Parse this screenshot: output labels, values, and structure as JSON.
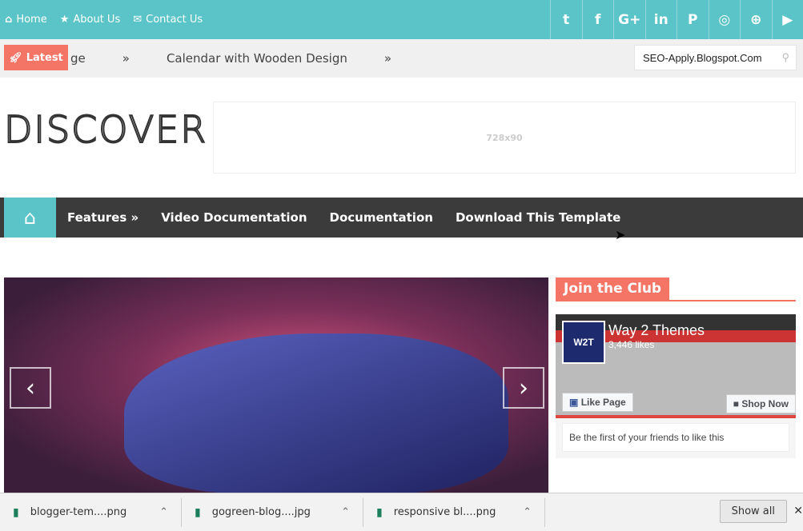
{
  "topbar": {
    "links": [
      {
        "icon": "home-icon",
        "label": "Home"
      },
      {
        "icon": "star-icon",
        "label": "About Us"
      },
      {
        "icon": "envelope-icon",
        "label": "Contact Us"
      }
    ],
    "social": [
      {
        "name": "twitter-icon",
        "glyph": "t"
      },
      {
        "name": "facebook-icon",
        "glyph": "f"
      },
      {
        "name": "google-plus-icon",
        "glyph": "G+"
      },
      {
        "name": "linkedin-icon",
        "glyph": "in"
      },
      {
        "name": "pinterest-icon",
        "glyph": "P"
      },
      {
        "name": "instagram-icon",
        "glyph": "◎"
      },
      {
        "name": "dribbble-icon",
        "glyph": "⊕"
      },
      {
        "name": "youtube-icon",
        "glyph": "▶"
      }
    ]
  },
  "ticker": {
    "badge": "Latest",
    "items": [
      "ge",
      "»",
      "Calendar with Wooden Design",
      "»"
    ],
    "search_value": "SEO-Apply.Blogspot.Com"
  },
  "header": {
    "logo": "DISCOVER",
    "ad": "728x90"
  },
  "nav": {
    "items": [
      "Features »",
      "Video Documentation",
      "Documentation",
      "Download This Template"
    ]
  },
  "slider": {
    "prev": "‹",
    "next": "›"
  },
  "sidebar": {
    "title": "Join the Club",
    "fb": {
      "avatar": "W2T",
      "name": "Way 2 Themes",
      "likes": "3,446 likes",
      "like_btn": "Like Page",
      "shop_btn": "Shop Now",
      "friends": "Be the first of your friends to like this"
    }
  },
  "downloads": {
    "items": [
      "blogger-tem....png",
      "gogreen-blog....jpg",
      "responsive bl....png"
    ],
    "show_all": "Show all",
    "close": "✕"
  },
  "colors": {
    "teal": "#5bc4c8",
    "coral": "#f47466",
    "nav": "#3b3b3b"
  }
}
